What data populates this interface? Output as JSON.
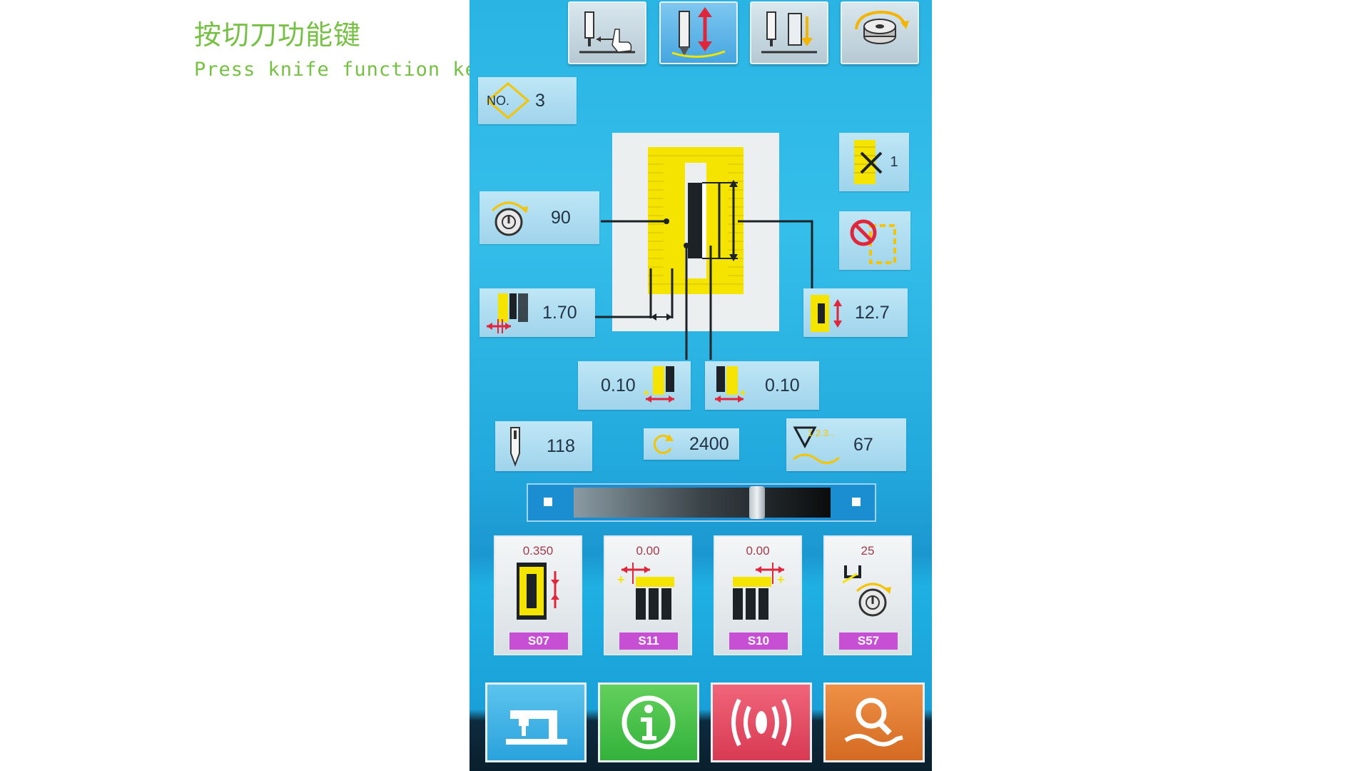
{
  "caption": {
    "chinese": "按切刀功能键",
    "english": "Press knife function key"
  },
  "top_toolbar": [
    {
      "name": "threading-mode-button",
      "icon": "needle-hand-icon",
      "active": false
    },
    {
      "name": "knife-up-down-button",
      "icon": "knife-updown-icon",
      "active": true
    },
    {
      "name": "presser-down-button",
      "icon": "presser-down-icon",
      "active": false
    },
    {
      "name": "winding-button",
      "icon": "bobbin-winding-icon",
      "active": false
    }
  ],
  "pattern_no": {
    "label": "NO.",
    "value": "3"
  },
  "tension": {
    "value": "90"
  },
  "cutting_space": {
    "value": "1.70"
  },
  "counter": {
    "value": "1"
  },
  "knife_length": {
    "value": "12.7"
  },
  "left_offset": {
    "value": "0.10"
  },
  "right_offset": {
    "value": "0.10"
  },
  "needle_count": {
    "value": "118"
  },
  "speed": {
    "value": "2400"
  },
  "counter_total": {
    "label": "1.2.3..",
    "value": "67"
  },
  "param_cards": [
    {
      "value": "0.350",
      "tag": "S07"
    },
    {
      "value": "0.00",
      "tag": "S11"
    },
    {
      "value": "0.00",
      "tag": "S10"
    },
    {
      "value": "25",
      "tag": "S57"
    }
  ],
  "bottom_nav": [
    {
      "icon": "sewing-machine-icon",
      "color": "#3fb3e6"
    },
    {
      "icon": "info-icon",
      "color": "#3ec64a"
    },
    {
      "icon": "communication-icon",
      "color": "#e8475f"
    },
    {
      "icon": "search-icon",
      "color": "#e0782c"
    }
  ],
  "colors": {
    "accent_yellow": "#f5e400",
    "tag_purple": "#c64fd4",
    "screen_blue": "#2ab4e4"
  }
}
